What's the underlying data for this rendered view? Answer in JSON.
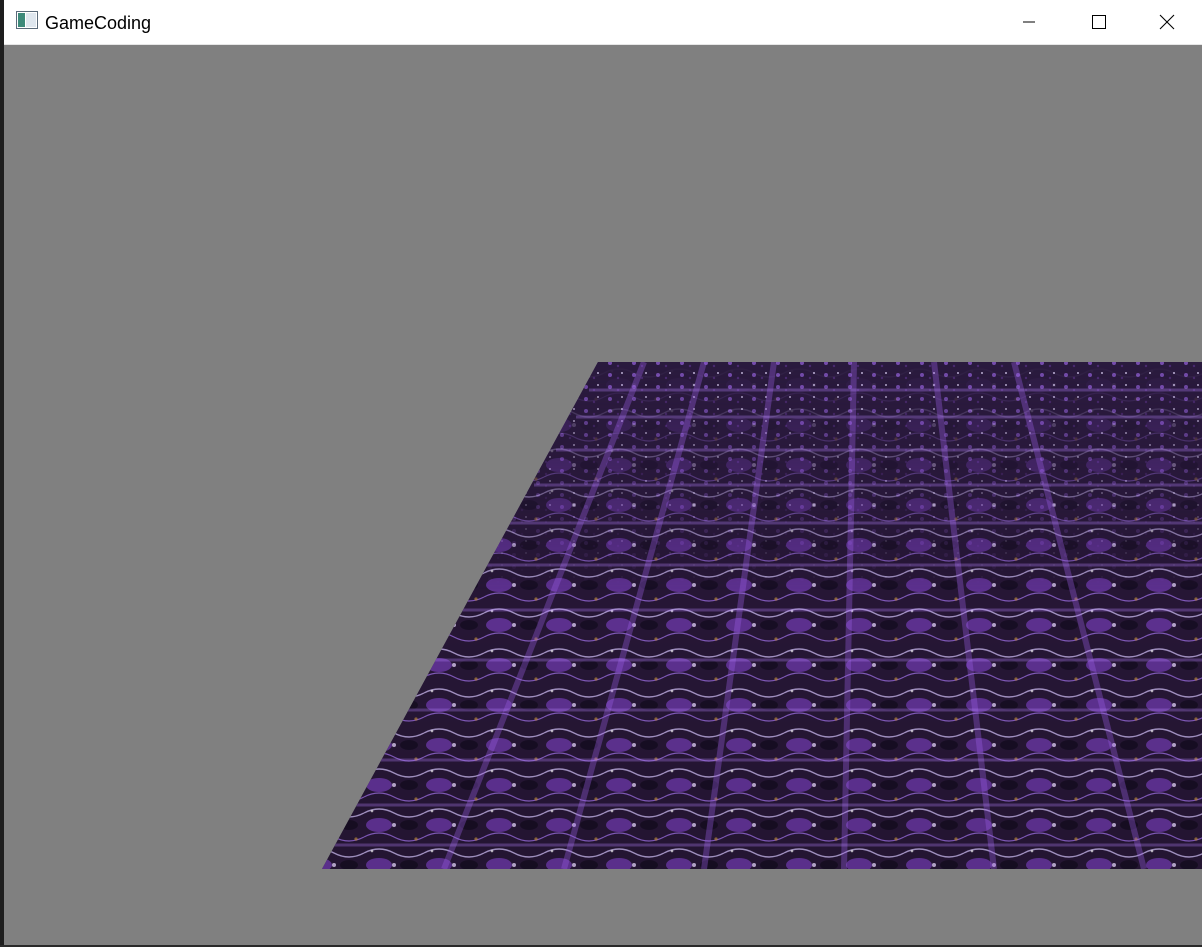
{
  "window": {
    "title": "GameCoding",
    "controls": {
      "minimize": "minimize-icon",
      "maximize": "maximize-icon",
      "close": "close-icon"
    }
  },
  "scene": {
    "background_color": "#808080",
    "floor_texture_colors": [
      "#1a0f2a",
      "#3a1a5c",
      "#8a3fd0",
      "#c7a6ff"
    ]
  }
}
